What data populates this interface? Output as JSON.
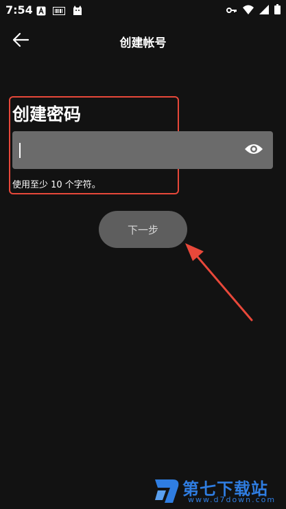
{
  "status_bar": {
    "time": "7:54",
    "left_icons": [
      "font-a-icon",
      "barcode-icon",
      "cat-icon"
    ],
    "right_icons": [
      "key-icon",
      "wifi-icon",
      "signal-icon",
      "battery-icon"
    ]
  },
  "app_bar": {
    "back_icon": "arrow-left-icon",
    "title": "创建帐号"
  },
  "form": {
    "section_title": "创建密码",
    "password_value": "",
    "visibility_icon": "eye-icon",
    "helper_text": "使用至少 10 个字符。",
    "next_label": "下一步"
  },
  "annotation": {
    "color": "#e8483a"
  },
  "watermark": {
    "logo_icon": "d7-logo-icon",
    "title": "第七下载站",
    "url": "www.d7down.com",
    "color": "#2f7de1"
  }
}
